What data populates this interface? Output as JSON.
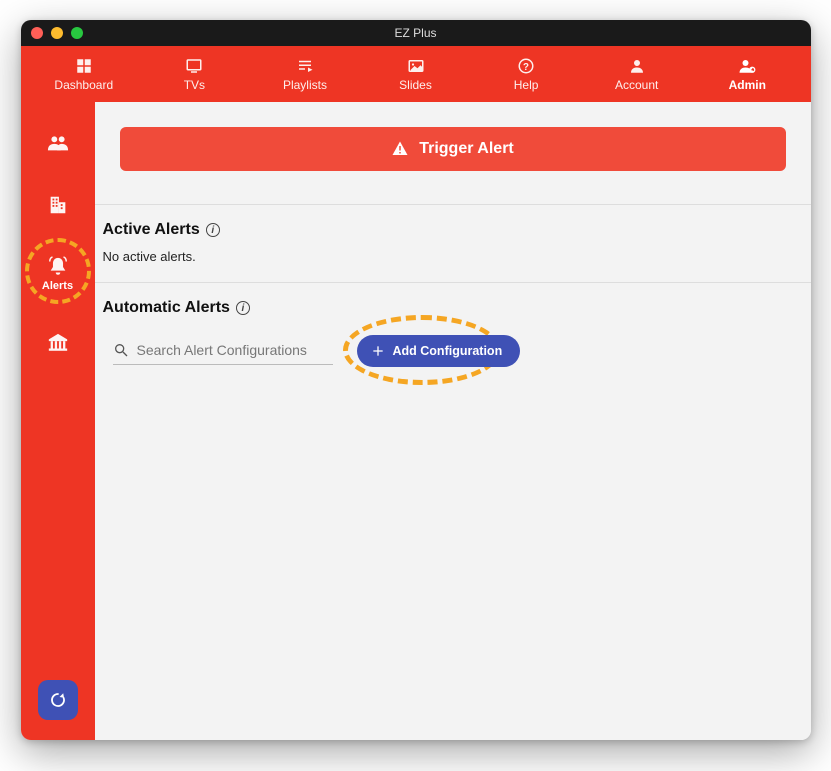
{
  "window": {
    "title": "EZ Plus"
  },
  "topnav": {
    "items": [
      {
        "label": "Dashboard",
        "icon": "dashboard-icon"
      },
      {
        "label": "TVs",
        "icon": "tv-icon"
      },
      {
        "label": "Playlists",
        "icon": "playlist-icon"
      },
      {
        "label": "Slides",
        "icon": "slides-icon"
      },
      {
        "label": "Help",
        "icon": "help-icon"
      },
      {
        "label": "Account",
        "icon": "account-icon"
      },
      {
        "label": "Admin",
        "icon": "admin-icon"
      }
    ],
    "active_index": 6
  },
  "sidebar": {
    "items": [
      {
        "label": "",
        "icon": "users-icon"
      },
      {
        "label": "",
        "icon": "building-icon"
      },
      {
        "label": "Alerts",
        "icon": "bell-icon"
      },
      {
        "label": "",
        "icon": "institution-icon"
      }
    ],
    "active_index": 2,
    "refresh_tooltip": "Refresh"
  },
  "trigger": {
    "label": "Trigger Alert"
  },
  "active_alerts": {
    "heading": "Active Alerts",
    "empty_text": "No active alerts."
  },
  "automatic_alerts": {
    "heading": "Automatic Alerts",
    "search_placeholder": "Search Alert Configurations",
    "add_configuration_label": "Add Configuration"
  },
  "colors": {
    "brand_red": "#ee3524",
    "accent_indigo": "#3f51b5",
    "highlight_orange": "#f5a623"
  }
}
